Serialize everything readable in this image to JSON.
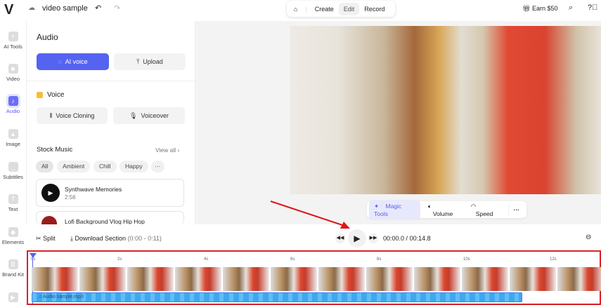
{
  "header": {
    "logo": "V",
    "project_title": "video sample",
    "nav": [
      "Create",
      "Edit",
      "Record"
    ],
    "active_nav": "Edit",
    "earn": "Earn $50"
  },
  "rail": [
    {
      "label": "AI Tools",
      "icon": "+"
    },
    {
      "label": "Video",
      "icon": "■"
    },
    {
      "label": "Audio",
      "icon": "♪"
    },
    {
      "label": "Image",
      "icon": "▲"
    },
    {
      "label": "Subtitles",
      "icon": "_"
    },
    {
      "label": "Text",
      "icon": "T"
    },
    {
      "label": "Elements",
      "icon": "◆"
    },
    {
      "label": "Brand Kit",
      "icon": "B"
    },
    {
      "label": "",
      "icon": "▶"
    }
  ],
  "panel": {
    "title": "Audio",
    "ai_voice": "AI voice",
    "upload": "Upload",
    "voice_heading": "Voice",
    "voice_cloning": "Voice Cloning",
    "voiceover": "Voiceover",
    "stock_music": "Stock Music",
    "view_all": "View all",
    "chips": [
      "All",
      "Ambient",
      "Chill",
      "Happy",
      "···"
    ],
    "tracks": [
      {
        "title": "Synthwave Memories",
        "duration": "2:56"
      },
      {
        "title": "Lofi Background Vlog Hip Hop"
      }
    ]
  },
  "video_tools": {
    "magic": "Magic Tools",
    "volume": "Volume",
    "speed": "Speed",
    "more": "···"
  },
  "controls": {
    "split": "Split",
    "download": "Download Section",
    "range": "(0:00 - 0:11)",
    "current": "00:00.0",
    "separator": "/",
    "total": "00:14.8"
  },
  "timeline": {
    "ticks": [
      "0s",
      "2s",
      "4s",
      "6s",
      "8s",
      "10s",
      "12s"
    ],
    "audio_clip": "Audio sample.mp3"
  },
  "colors": {
    "accent": "#5b63f0",
    "highlight": "#d9232a"
  }
}
